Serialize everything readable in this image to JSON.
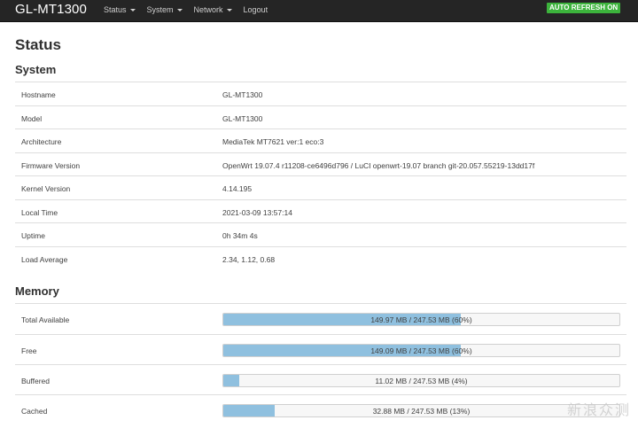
{
  "navbar": {
    "brand": "GL-MT1300",
    "menu": [
      "Status",
      "System",
      "Network"
    ],
    "logout": "Logout",
    "auto_refresh": "AUTO REFRESH ON",
    "colors": {
      "background": "#252525",
      "auto_refresh": "#3cb33c"
    }
  },
  "page": {
    "title": "Status"
  },
  "system": {
    "title": "System",
    "rows": [
      {
        "label": "Hostname",
        "value": "GL-MT1300"
      },
      {
        "label": "Model",
        "value": "GL-MT1300"
      },
      {
        "label": "Architecture",
        "value": "MediaTek MT7621 ver:1 eco:3"
      },
      {
        "label": "Firmware Version",
        "value": "OpenWrt 19.07.4 r11208-ce6496d796 / LuCI openwrt-19.07 branch git-20.057.55219-13dd17f"
      },
      {
        "label": "Kernel Version",
        "value": "4.14.195"
      },
      {
        "label": "Local Time",
        "value": "2021-03-09 13:57:14"
      },
      {
        "label": "Uptime",
        "value": "0h 34m 4s"
      },
      {
        "label": "Load Average",
        "value": "2.34, 1.12, 0.68"
      }
    ]
  },
  "memory": {
    "title": "Memory",
    "bar_color": "#8fc0df",
    "rows": [
      {
        "label": "Total Available",
        "text": "149.97 MB / 247.53 MB (60%)",
        "percent": 60
      },
      {
        "label": "Free",
        "text": "149.09 MB / 247.53 MB (60%)",
        "percent": 60
      },
      {
        "label": "Buffered",
        "text": "11.02 MB / 247.53 MB (4%)",
        "percent": 4
      },
      {
        "label": "Cached",
        "text": "32.88 MB / 247.53 MB (13%)",
        "percent": 13
      }
    ]
  },
  "watermark": "新浪众测"
}
